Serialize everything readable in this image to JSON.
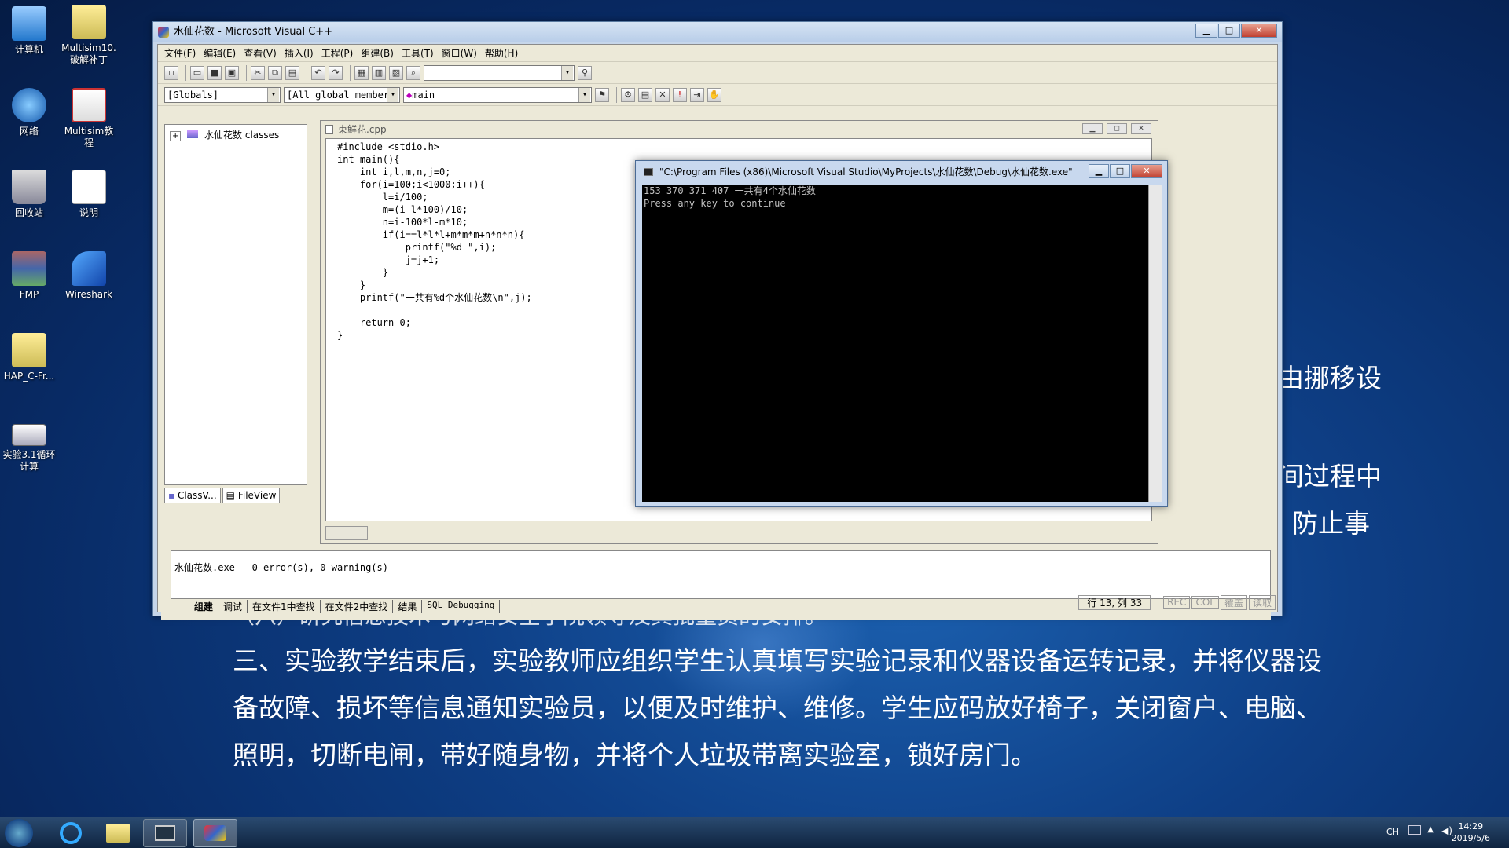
{
  "desktop": {
    "icons": [
      {
        "label": "计算机"
      },
      {
        "label": "Multisim10.\n破解补丁"
      },
      {
        "label": "网络"
      },
      {
        "label": "Multisim教\n程"
      },
      {
        "label": "回收站"
      },
      {
        "label": "说明"
      },
      {
        "label": "FMP"
      },
      {
        "label": "Wireshark"
      },
      {
        "label": "HAP_C-Fr..."
      },
      {
        "label": "实验3.1循环\n计算"
      }
    ],
    "bg_text": {
      "frag1": "由挪移设",
      "frag2": "间过程中",
      "frag3": "防止事",
      "partial_line": "（六）研究信息技术与网络安全学院领导及其批量员的安排。",
      "line1": "三、实验教学结束后，实验教师应组织学生认真填写实验记录和仪器设备运转记录，并将仪器设",
      "line2": "备故障、损坏等信息通知实验员，以便及时维护、维修。学生应码放好椅子，关闭窗户、电脑、",
      "line3": "照明，切断电闸，带好随身物，并将个人垃圾带离实验室，锁好房门。"
    }
  },
  "vc": {
    "title": "水仙花数 - Microsoft Visual C++",
    "menu": [
      "文件(F)",
      "编辑(E)",
      "查看(V)",
      "插入(I)",
      "工程(P)",
      "组建(B)",
      "工具(T)",
      "窗口(W)",
      "帮助(H)"
    ],
    "combo_globals": "[Globals]",
    "combo_members": "[All global members",
    "combo_func": "main",
    "workspace": {
      "tree_root": "水仙花数 classes",
      "tab_class": "ClassV...",
      "tab_file": "FileView"
    },
    "editor": {
      "title": "束鲜花.cpp",
      "code": "#include <stdio.h>\nint main(){\n    int i,l,m,n,j=0;\n    for(i=100;i<1000;i++){\n        l=i/100;\n        m=(i-l*100)/10;\n        n=i-100*l-m*10;\n        if(i==l*l*l+m*m*m+n*n*n){\n            printf(\"%d \",i);\n            j=j+1;\n        }\n    }\n    printf(\"一共有%d个水仙花数\\n\",j);\n\n    return 0;\n}"
    },
    "output": {
      "text": "水仙花数.exe - 0 error(s), 0 warning(s)",
      "tabs": [
        "组建",
        "调试",
        "在文件1中查找",
        "在文件2中查找",
        "结果",
        "SQL Debugging"
      ]
    },
    "status": {
      "pos": "行 13, 列 33",
      "rec": "REC",
      "col": "COL",
      "ovr": "覆盖",
      "read": "读取"
    }
  },
  "console": {
    "title": "\"C:\\Program Files (x86)\\Microsoft Visual Studio\\MyProjects\\水仙花数\\Debug\\水仙花数.exe\"",
    "line1": "153 370 371 407 一共有4个水仙花数",
    "line2": "Press any key to continue"
  },
  "taskbar": {
    "ime": "CH",
    "time": "14:29",
    "date": "2019/5/6"
  }
}
